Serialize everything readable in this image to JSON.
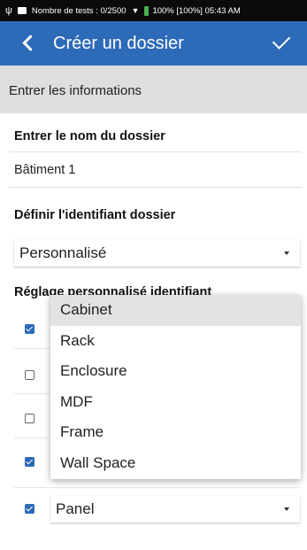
{
  "status_bar": {
    "left_text": "Nombre de tests : 0/2500",
    "right_text": "100% [100%] 05:43 AM"
  },
  "app_bar": {
    "title": "Créer un dossier"
  },
  "section_header": "Entrer les informations",
  "folder_name": {
    "label": "Entrer le nom du dossier",
    "value": "Bâtiment 1"
  },
  "identifier": {
    "label": "Définir l'identifiant dossier",
    "selected": "Personnalisé"
  },
  "custom_setting": {
    "label": "Réglage personnalisé identifiant",
    "rows": [
      {
        "checked": true
      },
      {
        "checked": false
      },
      {
        "checked": false
      },
      {
        "checked": true
      },
      {
        "checked": true,
        "selected": "Panel"
      }
    ]
  },
  "dropdown_menu": {
    "items": [
      "Cabinet",
      "Rack",
      "Enclosure",
      "MDF",
      "Frame",
      "Wall Space"
    ],
    "highlighted": "Cabinet"
  },
  "colors": {
    "app_bar": "#2d6ab8",
    "status_bar": "#0b0b0b",
    "section_header": "#dedede",
    "checkbox_on": "#2d6ab8",
    "battery": "#4caf50"
  }
}
